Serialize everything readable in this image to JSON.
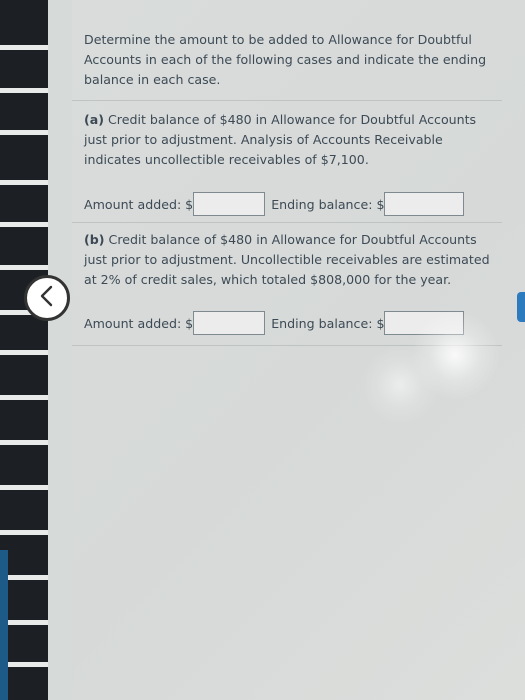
{
  "intro": "Determine the amount to be added to Allowance for Doubtful\nAccounts in each of the following cases and indicate the ending\nbalance in each case.",
  "case_a": {
    "label": "(a)",
    "text": " Credit balance of $480 in Allowance for Doubtful Accounts\njust prior to adjustment. Analysis of Accounts Receivable\nindicates uncollectible receivables of $7,100.",
    "amount_label": "Amount added: $",
    "amount_value": "",
    "ending_label": "Ending balance: $",
    "ending_value": ""
  },
  "case_b": {
    "label": "(b)",
    "text": " Credit balance of $480 in Allowance for Doubtful Accounts\njust prior to adjustment. Uncollectible receivables are estimated\nat 2% of credit sales, which totaled $808,000 for the year.",
    "amount_label": "Amount added: $",
    "amount_value": "",
    "ending_label": "Ending balance: $",
    "ending_value": ""
  },
  "icons": {
    "back": "chevron-left-icon"
  }
}
